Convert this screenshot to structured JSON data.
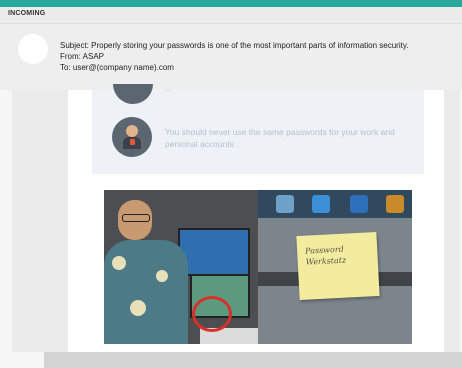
{
  "inbox": {
    "label": "INCOMING"
  },
  "email": {
    "subject": "Subject: Properly storing your passwords is one of the most important parts of information security.",
    "from": "From: ASAP",
    "to": "To: user@(company name).com"
  },
  "tips": {
    "faded_text": "...",
    "tip_text": "You should never use the same passwords for your work and personal accounts"
  },
  "photo": {
    "sticky_note_text": "Password Werkstatz",
    "annotation_color": "#d9302a"
  },
  "colors": {
    "accent": "#27a89b"
  }
}
